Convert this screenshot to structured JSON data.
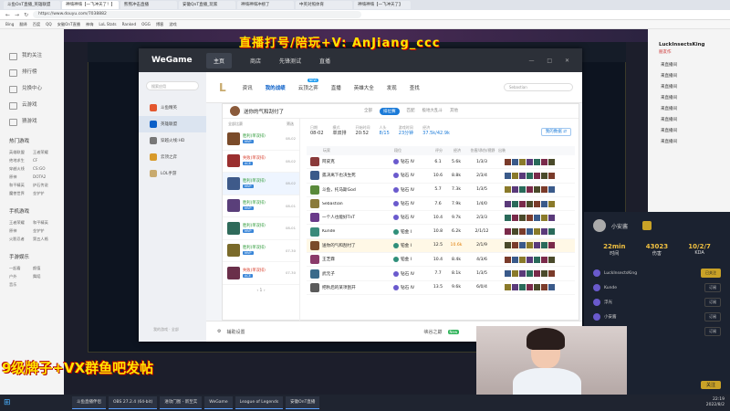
{
  "browser": {
    "tabs": [
      "斗鱼OnT直播_英雄联盟",
      "神嗨神嗨【一飞冲天了！】",
      "熊熊冲击直播",
      "安徽QnT直播_玩家",
      "神嗨神嗨冲榜了",
      "中英对照体育",
      "神嗨神嗨【一飞冲天了】"
    ],
    "url": "https://www.douyu.com/7038882",
    "bookmarks": [
      "Bing",
      "翻译",
      "百度",
      "QQ",
      "安徽OnT直播",
      "神嗨",
      "LoL Stats",
      "Ranked",
      "OGG",
      "博客",
      "游戏"
    ]
  },
  "douyu_sidebar": {
    "items": [
      "我的关注",
      "排行榜",
      "兑换中心",
      "云游戏",
      "猜游戏"
    ],
    "section_hot": "热门游戏",
    "hot_games": [
      "英雄联盟",
      "王者荣耀",
      "绝地求生",
      "CF",
      "穿越火线",
      "CS:GO",
      "原神",
      "DOTA2",
      "和平精英",
      "炉石传说",
      "魔兽世界",
      "金铲铲"
    ],
    "section_mobile": "手机游戏",
    "mobile_games": [
      "王者荣耀",
      "和平精英",
      "原神",
      "金铲铲",
      "火影忍者",
      "第五人格"
    ],
    "section_entertain": "手游娱乐",
    "entertain": [
      "一起看",
      "颜值",
      "户外",
      "舞蹈",
      "音乐"
    ]
  },
  "overlays": {
    "top_text": "直播打号/陪玩+V: AnJiang_ccc",
    "bottom_text": "9级牌子+VX群鱼吧发帖"
  },
  "wegame": {
    "logo": "WeGame",
    "nav": [
      "主页",
      "商店",
      "先锋测试",
      "直播"
    ],
    "window_controls": "— □ ✕",
    "search_placeholder": "搜索应用",
    "games": [
      {
        "name": "斗鱼精英",
        "color": "#e4572e"
      },
      {
        "name": "英雄联盟",
        "color": "#0a5fc8"
      },
      {
        "name": "穿越火线:HD",
        "color": "#777"
      },
      {
        "name": "云顶之弈",
        "color": "#d89a2a"
      },
      {
        "name": "LOL手游",
        "color": "#c8aa6e"
      }
    ],
    "left_footer": "我的游戏 · 全部",
    "lol_nav": [
      "资讯",
      "我的战绩",
      "云顶之弈",
      "直播",
      "英雄大全",
      "发现",
      "查找"
    ],
    "lol_nav_new_label": "NEW",
    "lol_search": "Sebastian",
    "lol_mark": "L",
    "footer_left": "辅助设置",
    "footer_mid": "峡谷之巅",
    "footer_badge": "New"
  },
  "card": {
    "player": "送你的气和刮付了",
    "filters": [
      "全部",
      "排位赛",
      "匹配",
      "极地大乱斗",
      "其他"
    ],
    "active_filter": "排位赛",
    "matchlist_header_left": "全部比赛",
    "matchlist_header_right": "筛选",
    "matches": [
      {
        "result": "胜利(单双排)",
        "tag": "MVP",
        "date": "08-02",
        "color": "#7a4b2a"
      },
      {
        "result": "失败(单双排)",
        "tag": "ACE",
        "date": "08-02",
        "color": "#9a2f2f"
      },
      {
        "result": "胜利(单双排)",
        "tag": "MVP",
        "date": "08-02",
        "color": "#3e5a8a"
      },
      {
        "result": "胜利(单双排)",
        "tag": "MVP",
        "date": "08-01",
        "color": "#5a3f7a"
      },
      {
        "result": "胜利(单双排)",
        "tag": "MVP",
        "date": "08-01",
        "color": "#2f6a5a"
      },
      {
        "result": "胜利(单双排)",
        "tag": "MVP",
        "date": "07-30",
        "color": "#7a6a2a"
      },
      {
        "result": "失败(单双排)",
        "tag": "ACE",
        "date": "07-30",
        "color": "#6a2f4a"
      }
    ],
    "matchlist_footer": "‹  1  ›",
    "stats": [
      {
        "label": "日期",
        "value": "08-02"
      },
      {
        "label": "模式",
        "value": "单双排"
      },
      {
        "label": "开始时间",
        "value": "20:52"
      },
      {
        "label": "人头",
        "value": "8/15"
      },
      {
        "label": "游戏时间",
        "value": "23分钟"
      },
      {
        "label": "经济",
        "value": "37.5k/42.9k"
      }
    ],
    "share_label": "我的数据 ⇄",
    "table_headers": [
      "玩家",
      "段位",
      "评分",
      "经济",
      "伤害/承伤/视野",
      "出装"
    ],
    "players": [
      {
        "name": "阿皮克",
        "rank": "钻石 IV",
        "score": "6.1",
        "gold": "5.6k",
        "kda": "1/3/3",
        "champ": "#8a3a3a",
        "rk": "#6a5acd",
        "me": false
      },
      {
        "name": "孤决离下也决生死",
        "rank": "钻石 IV",
        "score": "10.6",
        "gold": "8.8k",
        "kda": "2/3/4",
        "champ": "#3a5a8a",
        "rk": "#6a5acd",
        "me": false
      },
      {
        "name": "斗鱼，托马斯God",
        "rank": "钻石 IV",
        "score": "5.7",
        "gold": "7.3k",
        "kda": "1/3/5",
        "champ": "#5a8a3a",
        "rk": "#6a5acd",
        "me": false
      },
      {
        "name": "Sebastian",
        "rank": "钻石 IV",
        "score": "7.6",
        "gold": "7.9k",
        "kda": "1/4/0",
        "champ": "#8a7a3a",
        "rk": "#6a5acd",
        "me": false
      },
      {
        "name": "一个人也能好TnT",
        "rank": "钻石 IV",
        "score": "10.4",
        "gold": "9.7k",
        "kda": "2/3/3",
        "champ": "#6a3a8a",
        "rk": "#6a5acd",
        "me": false
      },
      {
        "name": "Kunde",
        "rank": "铂金 I",
        "score": "10.8",
        "gold": "6.2k",
        "kda": "2/1/12",
        "champ": "#3a8a7a",
        "rk": "#2f8f7a",
        "me": false
      },
      {
        "name": "送你的气和刮付了",
        "rank": "铂金 I",
        "score": "12.5",
        "gold": "10.6k",
        "kda": "2/1/9",
        "champ": "#7a4b2a",
        "rk": "#2f8f7a",
        "me": true
      },
      {
        "name": "王芝霖",
        "rank": "铂金 I",
        "score": "10.4",
        "gold": "8.4k",
        "kda": "4/3/6",
        "champ": "#8a3a6a",
        "rk": "#2f8f7a",
        "me": false
      },
      {
        "name": "武元子",
        "rank": "钻石 IV",
        "score": "7.7",
        "gold": "8.1k",
        "kda": "1/3/5",
        "champ": "#3a6a8a",
        "rk": "#6a5acd",
        "me": false
      },
      {
        "name": "把秋后的某项刮开",
        "rank": "钻石 IV",
        "score": "13.5",
        "gold": "9.6k",
        "kda": "6/0/4",
        "champ": "#5a5a5a",
        "rk": "#6a5acd",
        "me": false
      }
    ]
  },
  "game_overlay": {
    "streamer": "小安酱",
    "stats": [
      {
        "value": "22min",
        "label": "时间"
      },
      {
        "value": "43023",
        "label": "伤害"
      },
      {
        "value": "10/2/7",
        "label": "KDA"
      }
    ],
    "rows": [
      {
        "name": "LuckInsectsKing",
        "btn": "已关注"
      },
      {
        "name": "Kunde",
        "btn": "订阅"
      },
      {
        "name": "浮光",
        "btn": "订阅"
      },
      {
        "name": "小安酱",
        "btn": "订阅"
      },
      {
        "name": "鱼丸",
        "btn": "订阅"
      }
    ],
    "foot_btn": "关注"
  },
  "right_panel": {
    "title": "LuckInsectsKing",
    "subtitle": "朋友作",
    "rows": [
      "来直播间",
      "来直播间",
      "来直播间",
      "来直播间",
      "来直播间",
      "来直播间",
      "来直播间",
      "来直播间"
    ]
  },
  "taskbar": {
    "items": [
      "斗鱼直播伴侣",
      "OBS 27.2.4 (64-bit)",
      "进攻门图 - 新至实",
      "WeGame",
      "League of Legends",
      "安徽OnT直播"
    ],
    "time": "22:19",
    "date": "2022/8/2"
  }
}
